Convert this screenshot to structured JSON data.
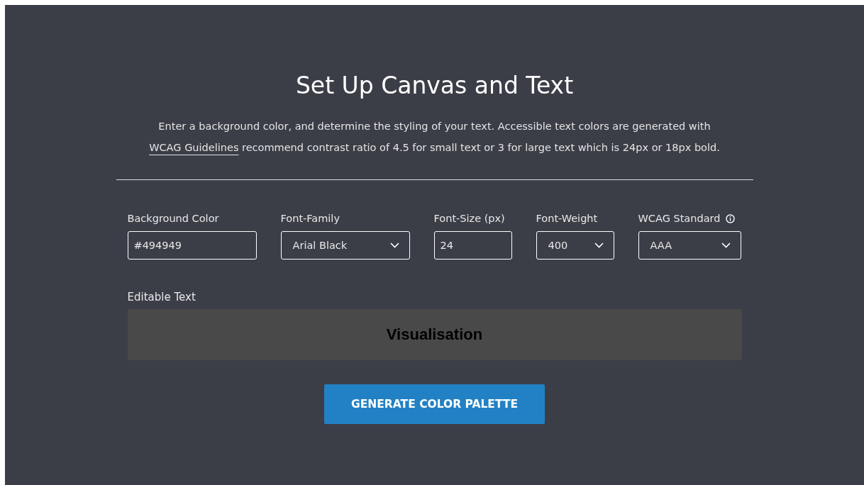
{
  "title": "Set Up Canvas and Text",
  "description": {
    "text": "Enter a background color, and determine the styling of your text. Accessible text colors are generated with",
    "link": "WCAG Guidelines",
    "after": "recommend contrast ratio of 4.5 for small text or 3 for large text which is 24px or 18px bold."
  },
  "fields": [
    {
      "label": "Background Color",
      "kind": "text",
      "value": "#494949",
      "info": false
    },
    {
      "label": "Font-Family",
      "kind": "select",
      "value": "Arial Black",
      "info": false
    },
    {
      "label": "Font-Size (px)",
      "kind": "text",
      "value": "24",
      "info": false
    },
    {
      "label": "Font-Weight",
      "kind": "select",
      "value": "400",
      "info": false
    },
    {
      "label": "WCAG Standard",
      "kind": "select",
      "value": "AAA",
      "info": true
    }
  ],
  "editable": {
    "label": "Editable Text",
    "text": "Visualisation"
  },
  "button": "GENERATE COLOR PALETTE"
}
